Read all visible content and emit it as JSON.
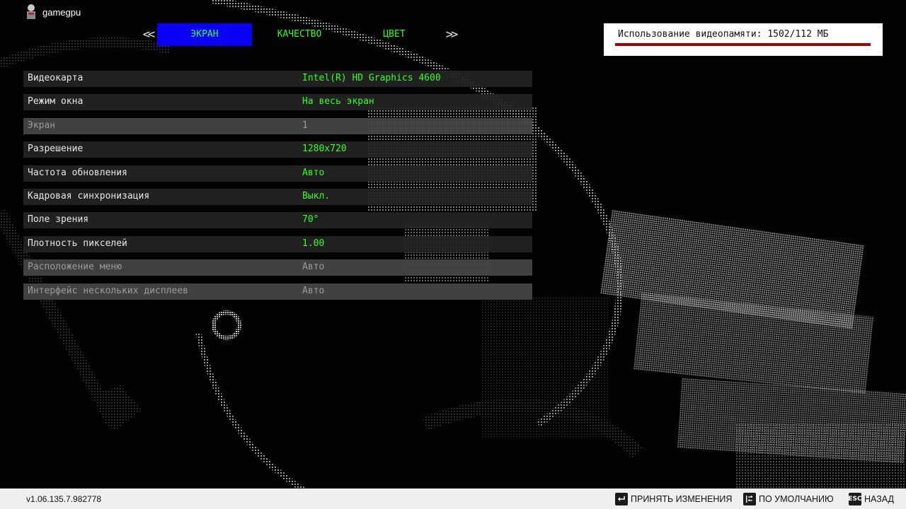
{
  "user": {
    "name": "gamegpu"
  },
  "tabs": {
    "prev_arrow": "<<",
    "next_arrow": ">>",
    "items": [
      {
        "label": "ЭКРАН"
      },
      {
        "label": "КАЧЕСТВО"
      },
      {
        "label": "ЦВЕТ"
      }
    ]
  },
  "vram": {
    "label": "Использование видеопамяти: 1502/112 МБ"
  },
  "settings": [
    {
      "label": "Видеокарта",
      "value": "Intel(R) HD Graphics 4600"
    },
    {
      "label": "Режим окна",
      "value": "На весь экран"
    },
    {
      "label": "Экран",
      "value": "1"
    },
    {
      "label": "Разрешение",
      "value": "1280x720"
    },
    {
      "label": "Частота обновления",
      "value": "Авто"
    },
    {
      "label": "Кадровая синхронизация",
      "value": "Выкл."
    },
    {
      "label": "Поле зрения",
      "value": "70°"
    },
    {
      "label": "Плотность пикселей",
      "value": "1.00"
    },
    {
      "label": "Расположение меню",
      "value": "Авто"
    },
    {
      "label": "Интерфейс нескольких дисплеев",
      "value": "Авто"
    }
  ],
  "footer": {
    "version": "v1.06.135.7.982778",
    "apply_label": "ПРИНЯТЬ ИЗМЕНЕНИЯ",
    "default_label": "ПО УМОЛЧАНИЮ",
    "back_label": "НАЗАД",
    "esc_key": "ESC"
  },
  "colors": {
    "active_tab": "#0a00f5",
    "value_text": "#33ff22",
    "vram_bar": "#a00000"
  },
  "icons": {
    "apply": "enter-key-icon",
    "default": "reset-key-icon",
    "back": "esc-key-icon"
  }
}
